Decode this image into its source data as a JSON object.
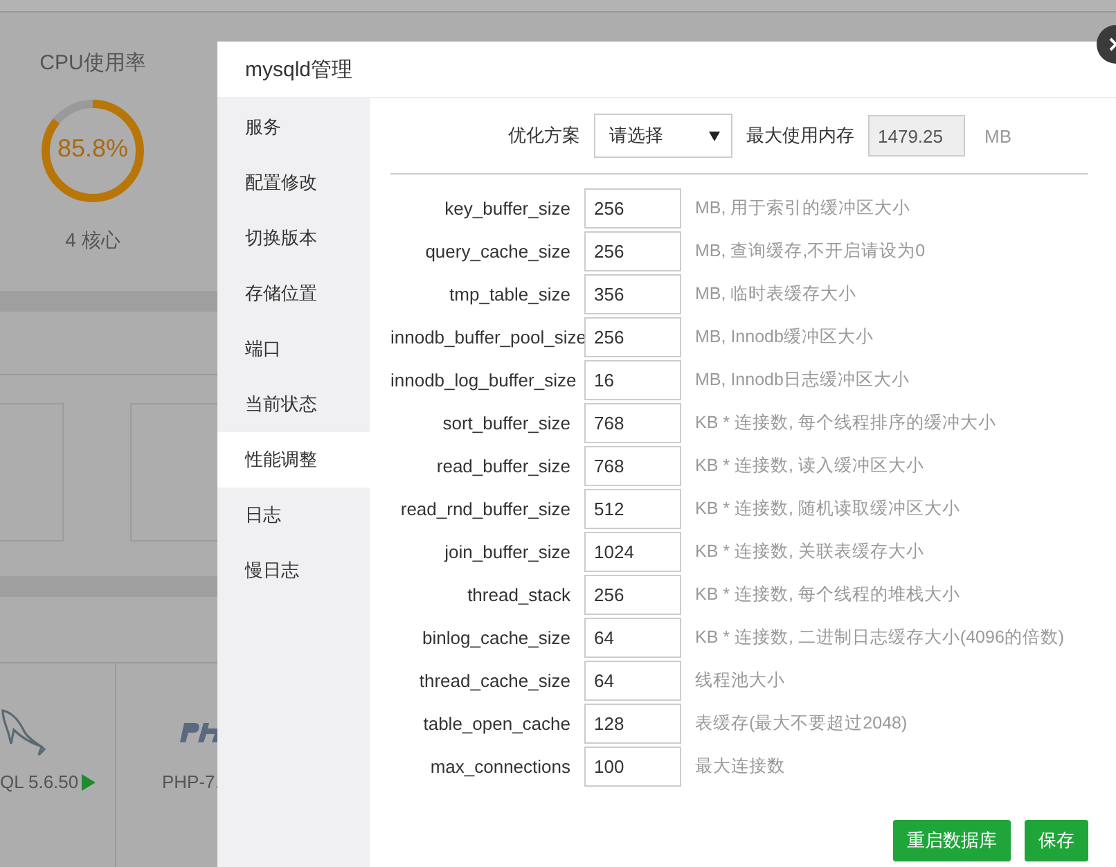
{
  "background": {
    "cpu": {
      "title": "CPU使用率",
      "value": "85.8%",
      "level": 0.858,
      "cores": "4 核心"
    },
    "software": [
      {
        "name": "QL 5.6.50",
        "running": true
      },
      {
        "name": "PHP-7.",
        "running": false
      }
    ]
  },
  "dialog": {
    "title": "mysqld管理",
    "sidebar": {
      "items": [
        {
          "label": "服务",
          "selected": false
        },
        {
          "label": "配置修改",
          "selected": false
        },
        {
          "label": "切换版本",
          "selected": false
        },
        {
          "label": "存储位置",
          "selected": false
        },
        {
          "label": "端口",
          "selected": false
        },
        {
          "label": "当前状态",
          "selected": false
        },
        {
          "label": "性能调整",
          "selected": true
        },
        {
          "label": "日志",
          "selected": false
        },
        {
          "label": "慢日志",
          "selected": false
        }
      ]
    },
    "optimize": {
      "label": "优化方案",
      "value": "请选择",
      "memory_label": "最大使用内存",
      "memory_value": "1479.25",
      "memory_unit": "MB"
    },
    "params": [
      {
        "name": "key_buffer_size",
        "value": "256",
        "hint": "MB, 用于索引的缓冲区大小"
      },
      {
        "name": "query_cache_size",
        "value": "256",
        "hint": "MB, 查询缓存,不开启请设为0"
      },
      {
        "name": "tmp_table_size",
        "value": "356",
        "hint": "MB, 临时表缓存大小"
      },
      {
        "name": "innodb_buffer_pool_size",
        "value": "256",
        "hint": "MB, Innodb缓冲区大小"
      },
      {
        "name": "innodb_log_buffer_size",
        "value": "16",
        "hint": "MB, Innodb日志缓冲区大小"
      },
      {
        "name": "sort_buffer_size",
        "value": "768",
        "hint": "KB * 连接数, 每个线程排序的缓冲大小"
      },
      {
        "name": "read_buffer_size",
        "value": "768",
        "hint": "KB * 连接数, 读入缓冲区大小"
      },
      {
        "name": "read_rnd_buffer_size",
        "value": "512",
        "hint": "KB * 连接数, 随机读取缓冲区大小"
      },
      {
        "name": "join_buffer_size",
        "value": "1024",
        "hint": "KB * 连接数, 关联表缓存大小"
      },
      {
        "name": "thread_stack",
        "value": "256",
        "hint": "KB * 连接数, 每个线程的堆栈大小"
      },
      {
        "name": "binlog_cache_size",
        "value": "64",
        "hint": "KB * 连接数, 二进制日志缓存大小(4096的倍数)"
      },
      {
        "name": "thread_cache_size",
        "value": "64",
        "hint": "线程池大小"
      },
      {
        "name": "table_open_cache",
        "value": "128",
        "hint": "表缓存(最大不要超过2048)"
      },
      {
        "name": "max_connections",
        "value": "100",
        "hint": "最大连接数"
      }
    ],
    "buttons": [
      "重启数据库",
      "保存"
    ]
  }
}
